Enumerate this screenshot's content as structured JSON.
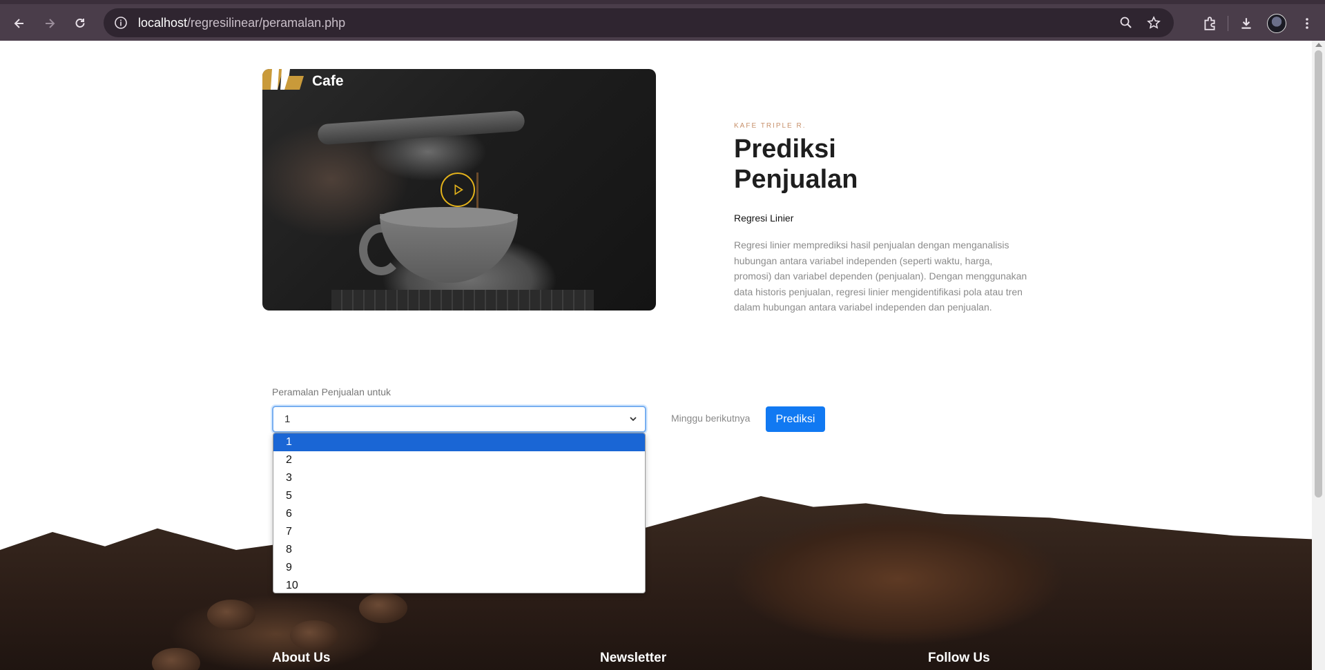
{
  "browser": {
    "url_host": "localhost",
    "url_path": "/regresilinear/peramalan.php"
  },
  "brand": {
    "name": "Cafe"
  },
  "about": {
    "kicker": "KAFE TRIPLE R.",
    "title_line1": "Prediksi",
    "title_line2": "Penjualan",
    "subtitle": "Regresi Linier",
    "description": "Regresi linier memprediksi hasil penjualan dengan menganalisis hubungan antara variabel independen (seperti waktu, harga, promosi) dan variabel dependen (penjualan). Dengan menggunakan data historis penjualan, regresi linier mengidentifikasi pola atau tren dalam hubungan antara variabel independen dan penjualan."
  },
  "form": {
    "label": "Peramalan Penjualan untuk",
    "selected_value": "1",
    "suffix": "Minggu berikutnya",
    "button_label": "Prediksi",
    "options": [
      "1",
      "2",
      "3",
      "5",
      "6",
      "7",
      "8",
      "9",
      "10"
    ]
  },
  "footer": {
    "about_heading": "About Us",
    "newsletter_heading": "Newsletter",
    "follow_heading": "Follow Us"
  },
  "colors": {
    "accent": "#1179f2",
    "play_ring": "#e3b21b",
    "kicker": "#c7906a",
    "selected_option": "#1a66d5"
  }
}
